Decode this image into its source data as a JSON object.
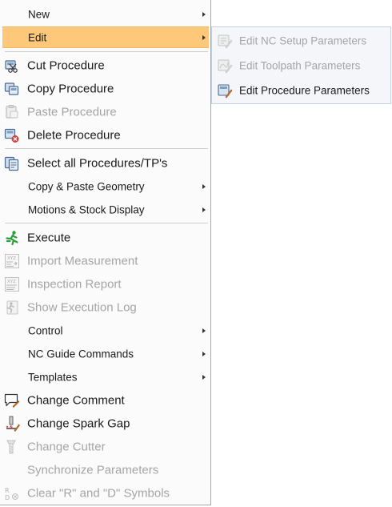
{
  "context_menu": {
    "items": {
      "new": "New",
      "edit": "Edit",
      "cut": "Cut  Procedure",
      "copy": "Copy Procedure",
      "paste": "Paste Procedure",
      "delete": "Delete Procedure",
      "select_all": "Select all Procedures/TP's",
      "copy_paste_geometry": "Copy & Paste Geometry",
      "motions_stock": "Motions & Stock Display",
      "execute": "Execute",
      "import_measurement": "Import Measurement",
      "inspection_report": "Inspection Report",
      "show_log": "Show Execution Log",
      "control": "Control",
      "nc_guide": "NC Guide Commands",
      "templates": "Templates",
      "change_comment": "Change Comment",
      "change_spark_gap": "Change Spark Gap",
      "change_cutter": "Change Cutter",
      "sync_params": "Synchronize Parameters",
      "clear_symbols": "Clear \"R\" and \"D\" Symbols"
    },
    "icons": {
      "cut": "cut-procedure-icon",
      "copy": "copy-procedure-icon",
      "paste": "paste-procedure-icon",
      "delete": "delete-procedure-icon",
      "select_all": "select-all-icon",
      "execute": "execute-runner-icon",
      "import_measurement": "xyz-import-icon",
      "inspection_report": "xyz-report-icon",
      "show_log": "execution-log-icon",
      "change_comment": "comment-icon",
      "change_spark_gap": "spark-gap-icon",
      "change_cutter": "cutter-icon",
      "clear_symbols": "rd-symbols-icon"
    }
  },
  "edit_submenu": {
    "items": {
      "nc_setup": "Edit NC Setup Parameters",
      "toolpath": "Edit Toolpath Parameters",
      "procedure": "Edit Procedure Parameters"
    }
  },
  "colors": {
    "highlight": "#fdc87a",
    "disabled_text": "#a5a5a5",
    "execute_green": "#2e9e3c",
    "delete_red": "#d83b3b"
  }
}
